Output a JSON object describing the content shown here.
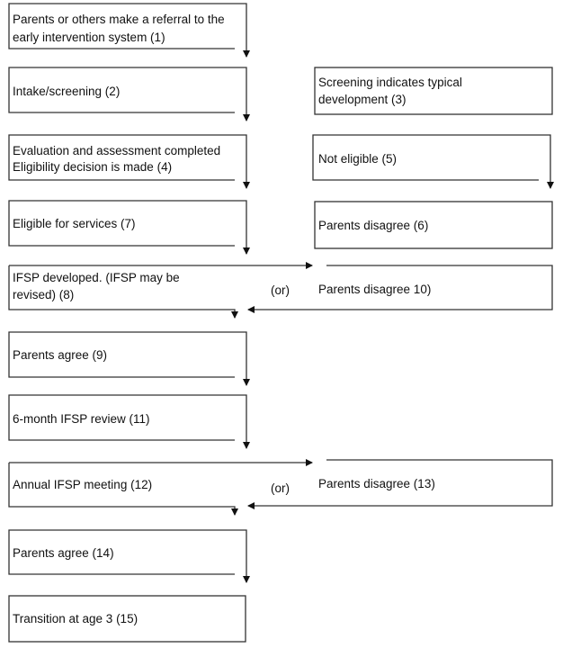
{
  "nodes": {
    "n1": [
      "Parents or others make a referral to the",
      "early intervention system  (1)"
    ],
    "n2": [
      "Intake/screening (2)"
    ],
    "n3": [
      "Screening indicates typical",
      "development (3)"
    ],
    "n4": [
      "Evaluation and assessment completed",
      "Eligibility decision is made (4)"
    ],
    "n5": [
      "Not eligible (5)"
    ],
    "n6": [
      "Parents disagree (6)"
    ],
    "n7": [
      "Eligible for services (7)"
    ],
    "n8": [
      "IFSP developed. (IFSP may be",
      "revised) (8)"
    ],
    "n10": [
      "Parents disagree 10)"
    ],
    "n9": [
      "Parents agree (9)"
    ],
    "n11": [
      "6-month IFSP review (11)"
    ],
    "n12": [
      "Annual IFSP meeting (12)"
    ],
    "n13": [
      "Parents disagree (13)"
    ],
    "n14": [
      "Parents agree (14)"
    ],
    "n15": [
      "Transition at age 3 (15)"
    ]
  },
  "connectors": {
    "or_1": "(or)",
    "or_2": "(or)"
  }
}
